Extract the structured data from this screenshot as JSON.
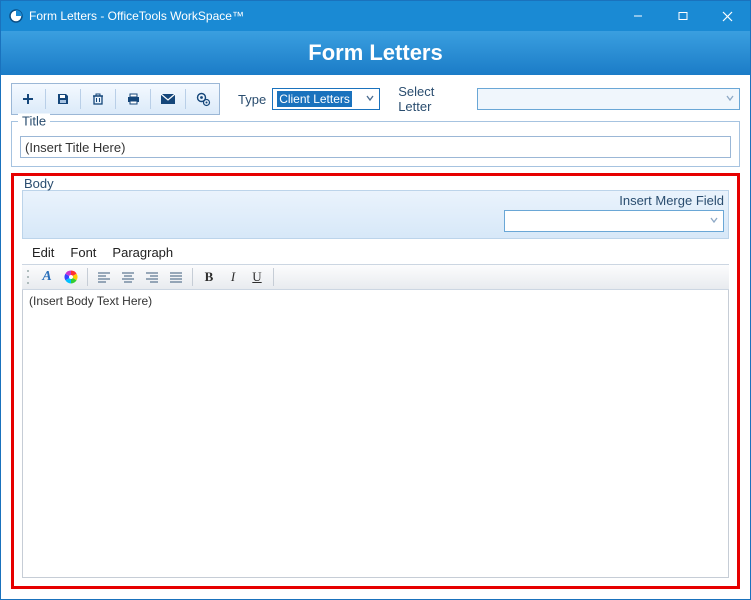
{
  "window": {
    "title": "Form Letters - OfficeTools WorkSpace™"
  },
  "banner": {
    "heading": "Form Letters"
  },
  "toolbar": {
    "icons": {
      "new": "new-icon",
      "save": "save-icon",
      "delete": "delete-icon",
      "print": "print-icon",
      "email": "email-icon",
      "settings": "settings-icon"
    }
  },
  "type": {
    "label": "Type",
    "selected": "Client Letters"
  },
  "selectLetter": {
    "label": "Select Letter",
    "selected": ""
  },
  "titleGroup": {
    "legend": "Title",
    "value": "(Insert Title Here)"
  },
  "bodyGroup": {
    "legend": "Body",
    "mergeLabel": "Insert Merge Field",
    "mergeSelected": "",
    "menu": {
      "edit": "Edit",
      "font": "Font",
      "paragraph": "Paragraph"
    },
    "bodyText": "(Insert Body Text Here)"
  }
}
